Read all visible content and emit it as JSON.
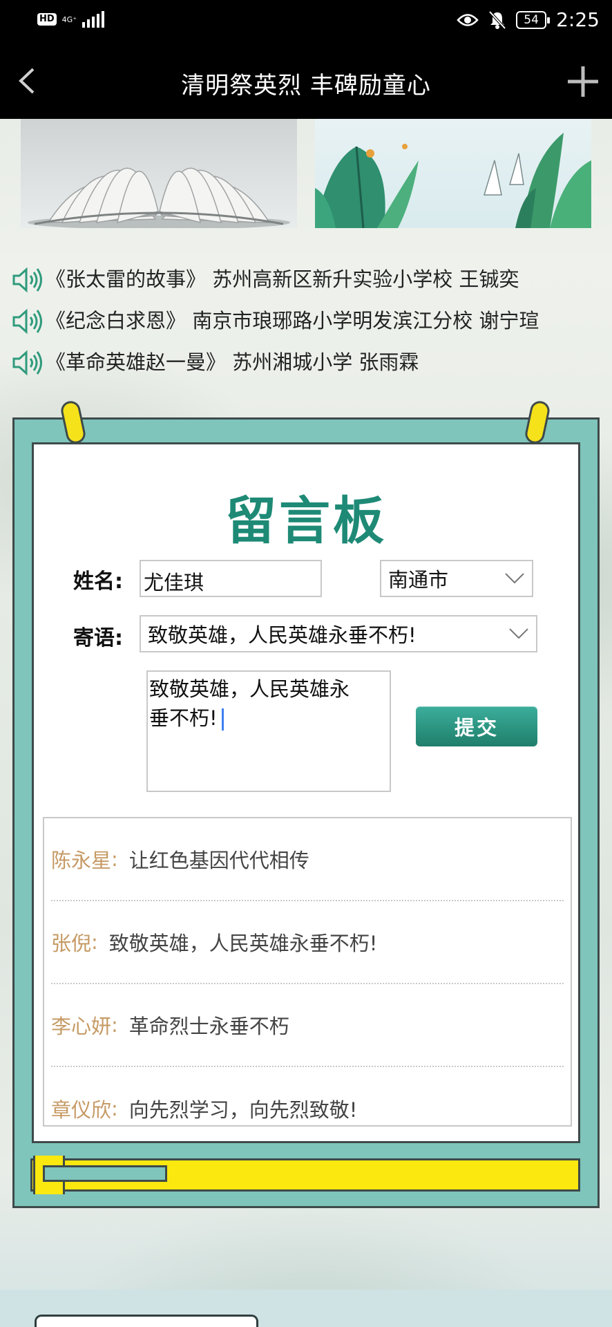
{
  "status_bar": {
    "hd": "HD",
    "network": "4G⁺",
    "battery": "54",
    "time": "2:25"
  },
  "nav": {
    "title": "清明祭英烈 丰碑励童心",
    "back_icon": "chevron-left-icon",
    "add_icon": "plus-icon"
  },
  "audio_items": [
    {
      "text": "《张太雷的故事》 苏州高新区新升实验小学校 王铖奕"
    },
    {
      "text": "《纪念白求恩》 南京市琅琊路小学明发滨江分校 谢宁瑄"
    },
    {
      "text": "《革命英雄赵一曼》 苏州湘城小学 张雨霖"
    }
  ],
  "board": {
    "title": "留言板",
    "name_label": "姓名:",
    "name_value": "尤佳琪",
    "city_value": "南通市",
    "message_label": "寄语:",
    "message_value": "致敬英雄，人民英雄永垂不朽!",
    "textarea_line1": "致敬英雄，人民英雄永",
    "textarea_line2": "垂不朽!",
    "submit_label": "提交"
  },
  "comments": [
    {
      "name": "陈永星",
      "text": "让红色基因代代相传"
    },
    {
      "name": "张倪",
      "text": "致敬英雄，人民英雄永垂不朽!"
    },
    {
      "name": "李心妍",
      "text": "革命烈士永垂不朽"
    },
    {
      "name": "章仪欣",
      "text": "向先烈学习，向先烈致敬!"
    }
  ],
  "colors": {
    "accent": "#1e8a76",
    "board_frame": "#7fc5bc",
    "clip_yellow": "#f5e21a",
    "comment_name": "#c69a64"
  }
}
